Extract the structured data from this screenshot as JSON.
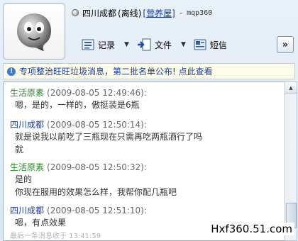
{
  "header": {
    "contact_name": "四川成都",
    "status_text": "(离线)",
    "shop_link": "[营养屋]",
    "separator": "-",
    "account_id": "mqp360"
  },
  "toolbar": {
    "record_label": "记录",
    "file_label": "文件",
    "sms_label": "短信",
    "more_label": "»"
  },
  "notice": {
    "icon_text": "!",
    "text": "专项整治旺旺垃圾消息，第二批名单公布! 点此查看"
  },
  "messages": [
    {
      "sender": "生活原素",
      "time": "(2009-08-05 12:49:46):",
      "lines": [
        "嗯，是的，一样的，傲挺装是6瓶"
      ]
    },
    {
      "sender": "四川成都",
      "time": "(2009-08-05 12:50:14):",
      "lines": [
        "就是说我以前吃了三瓶现在只需再吃两瓶酒行了吗",
        "就"
      ]
    },
    {
      "sender": "生活原素",
      "time": "(2009-08-05 12:50:32):",
      "lines": [
        "是的",
        "你现在服用的效果怎么样，我帮你配几瓶吧"
      ]
    },
    {
      "sender": "四川成都",
      "time": "(2009-08-05 12:51:10):",
      "lines": [
        "嗯，有点效果"
      ]
    }
  ],
  "footer": {
    "last_message": "最后一条消息收于 13:41:59"
  },
  "watermark": "Hxf360.51.com",
  "colors": {
    "seller_green": "#2a8a2a",
    "buyer_blue": "#1a3ea0"
  }
}
